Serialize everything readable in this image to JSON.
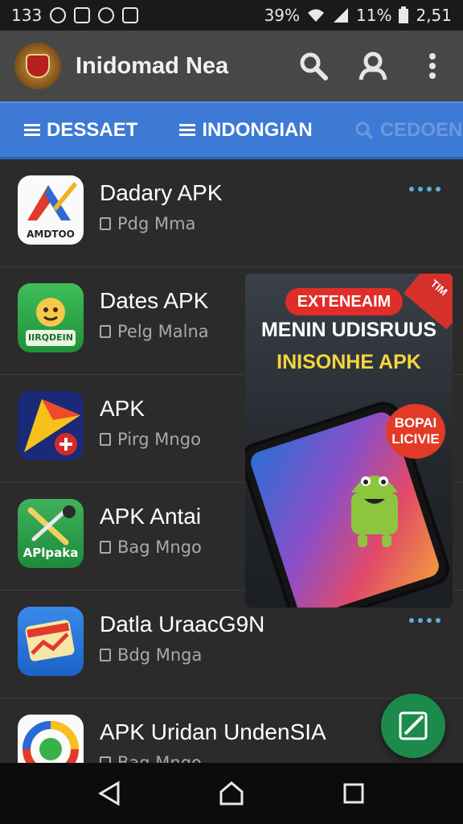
{
  "status_bar": {
    "left_text": "133",
    "battery_a": "39%",
    "battery_b": "11%",
    "clock": "2,51"
  },
  "app_bar": {
    "title": "Inidomad Nea",
    "icons": [
      "search-icon",
      "account-icon",
      "more-vert-icon"
    ]
  },
  "tabs": [
    {
      "label": "DESSAET",
      "icon": "list-icon"
    },
    {
      "label": "INDONGIAN",
      "icon": "list-icon"
    },
    {
      "label": "CEDOEN",
      "icon": "search-icon"
    }
  ],
  "apps": [
    {
      "name": "Dadary APK",
      "sub": "Pdg Mma",
      "icon_label": "AMDTOO",
      "menu": true
    },
    {
      "name": "Dates APK",
      "sub": "Pelg Malna",
      "icon_label": "IIRQDEIN",
      "menu": false
    },
    {
      "name": "APK",
      "sub": "Pirg Mngo",
      "icon_label": "",
      "menu": false
    },
    {
      "name": "APK Antai",
      "sub": "Bag Mngo",
      "icon_label": "APlpaka",
      "menu": false
    },
    {
      "name": "Datla UraacG9N",
      "sub": "Bdg Mnga",
      "icon_label": "",
      "menu": true
    },
    {
      "name": "APK Uridan UndenSIA",
      "sub": "Bag Mngo",
      "icon_label": "",
      "menu": false
    }
  ],
  "ad": {
    "pill": "EXTENEAIM",
    "corner": "TIM",
    "headline": "MENIN UDISRUUS",
    "subheadline": "INISONHE APK",
    "bubble_line1": "BOPAI",
    "bubble_line2": "LICIVIE"
  },
  "colors": {
    "tab_bar": "#3d7ad6",
    "app_bar": "#474747",
    "fab": "#1c8a4a",
    "menu_dots": "#5ab0e0"
  }
}
